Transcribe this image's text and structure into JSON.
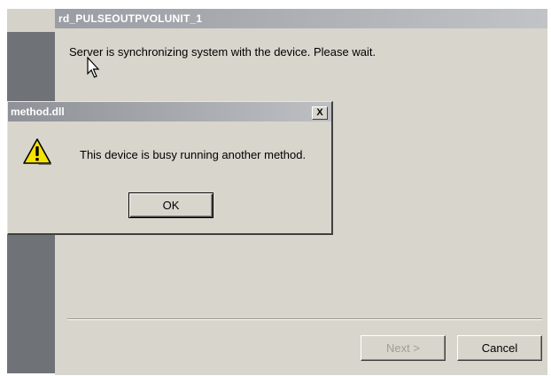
{
  "wizard": {
    "title": "rd_PULSEOUTPVOLUNIT_1",
    "message": "Server is synchronizing system with the device. Please wait.",
    "next_label": "Next >",
    "cancel_label": "Cancel"
  },
  "dialog": {
    "title": "method.dll",
    "close_label": "X",
    "message": "This device is busy running another method.",
    "ok_label": "OK",
    "icon": "warning-icon"
  },
  "colors": {
    "window_bg": "#d8d5cc",
    "titlebar_inactive": "#9a9da3",
    "warning_yellow": "#f5e300"
  }
}
